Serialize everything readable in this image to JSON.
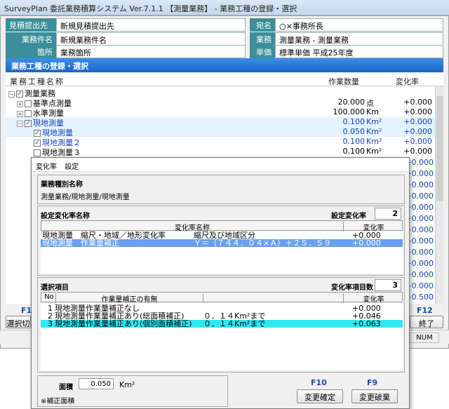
{
  "window": {
    "title": "SurveyPlan 委託業務積算システム Ver.7.1.1 【測量業務】 - 業務工種の登録・選択"
  },
  "header": {
    "estimate_to_label": "見積提出先",
    "estimate_to_value": "新規見積提出先",
    "recipient_label": "宛名",
    "recipient_value": "○×事務所長",
    "project_name_label": "業務件名",
    "project_name_value": "新規業務件名",
    "business_label": "業務",
    "business_value": "測量業務 - 測量業務",
    "location_label": "箇所",
    "location_value": "業務箇所",
    "unit_price_label": "単価",
    "unit_price_value": "標準単価 平成25年度"
  },
  "group_bar": {
    "title": "業務工種の登録・選択"
  },
  "list": {
    "columns": {
      "name": "業務工種名称",
      "quantity": "作業数量",
      "rate": "変化率"
    },
    "rows": [
      {
        "name": "測量業務",
        "checked": true,
        "expander": "−",
        "qty": "",
        "unit": "",
        "rate": "",
        "blue": false,
        "sel": false
      },
      {
        "name": "基準点測量",
        "checked": false,
        "expander": "+",
        "qty": "20.000",
        "unit": "点",
        "rate": "+0.000",
        "blue": false,
        "sel": false
      },
      {
        "name": "水準測量",
        "checked": false,
        "expander": "+",
        "qty": "100.000",
        "unit": "Km",
        "rate": "+0.000",
        "blue": false,
        "sel": false
      },
      {
        "name": "現地測量",
        "checked": true,
        "expander": "−",
        "qty": "0.100",
        "unit": "Km²",
        "rate": "+0.000",
        "blue": true,
        "sel": true
      },
      {
        "name": "現地測量",
        "checked": true,
        "expander": "",
        "qty": "0.050",
        "unit": "Km²",
        "rate": "+0.000",
        "blue": true,
        "sel": true
      },
      {
        "name": "現地測量２",
        "checked": true,
        "expander": "",
        "qty": "0.100",
        "unit": "Km²",
        "rate": "+0.000",
        "blue": true,
        "sel": false
      },
      {
        "name": "現地測量３",
        "checked": false,
        "expander": "",
        "qty": "0.100",
        "unit": "Km²",
        "rate": "+0.000",
        "blue": false,
        "sel": false
      }
    ],
    "hidden_rate_values": [
      "+0.000",
      "+0.000",
      "+0.000",
      "+0.000",
      "+0.000",
      "+0.000",
      "+0.000",
      "+0.000",
      "+0.000",
      "+0.000",
      "+0.000",
      "+0.000",
      "+0.500"
    ]
  },
  "footer": {
    "f1_key": "F1",
    "f1_label": "選択切",
    "f12_key": "F12",
    "f12_label": "終了"
  },
  "statusbar": {
    "num": "NUM"
  },
  "dialog": {
    "menu_rate": "変化率",
    "menu_settings": "設定",
    "category_title": "業務種別名称",
    "category_value": "測量業務/現地測量/現地測量",
    "setting_title": "設定変化率名称",
    "setting_count_label": "設定変化率",
    "setting_count": "2",
    "setting_columns": {
      "name": "変化率名称",
      "rate": "変化率"
    },
    "setting_rows": [
      {
        "name": "現地測量　縮尺・地域／地形変化率",
        "detail": "縮尺及び地域区分",
        "rate": "+0.000",
        "sel": false
      },
      {
        "name": "現地測量　作業量補正",
        "detail": "Ｙ＝（７４４．０４×Ａ）＋２５．５９",
        "rate": "+0.000",
        "sel": true
      }
    ],
    "select_title": "選択項目",
    "select_count_label": "変化率項目数",
    "select_count": "3",
    "select_columns": {
      "no": "No",
      "name": "作業量補正の有無",
      "rate": "変化率"
    },
    "select_rows": [
      {
        "no": "1",
        "name": "現地測量作業量補正なし",
        "detail": "",
        "rate": "+0.000",
        "sel": false
      },
      {
        "no": "2",
        "name": "現地測量作業量補正あり(総面積補正)",
        "detail": "０．１４Km²まで",
        "rate": "+0.046",
        "sel": false
      },
      {
        "no": "3",
        "name": "現地測量作業量補正あり(個別面積補正)",
        "detail": "０．１４Km²まで",
        "rate": "+0.063",
        "sel": true
      }
    ],
    "area_label": "面積",
    "area_value": "0.050",
    "area_unit": "Km²",
    "area_note": "※補正面積",
    "f10_key": "F10",
    "confirm_label": "変更確定",
    "f9_key": "F9",
    "cancel_label": "変更破棄"
  },
  "colors": {
    "header_label_bg": "#3a8f9a",
    "group_bar": "#1a66c7",
    "selection_blue": "#6aa0f0",
    "selection_cyan": "#2ee8f2"
  }
}
